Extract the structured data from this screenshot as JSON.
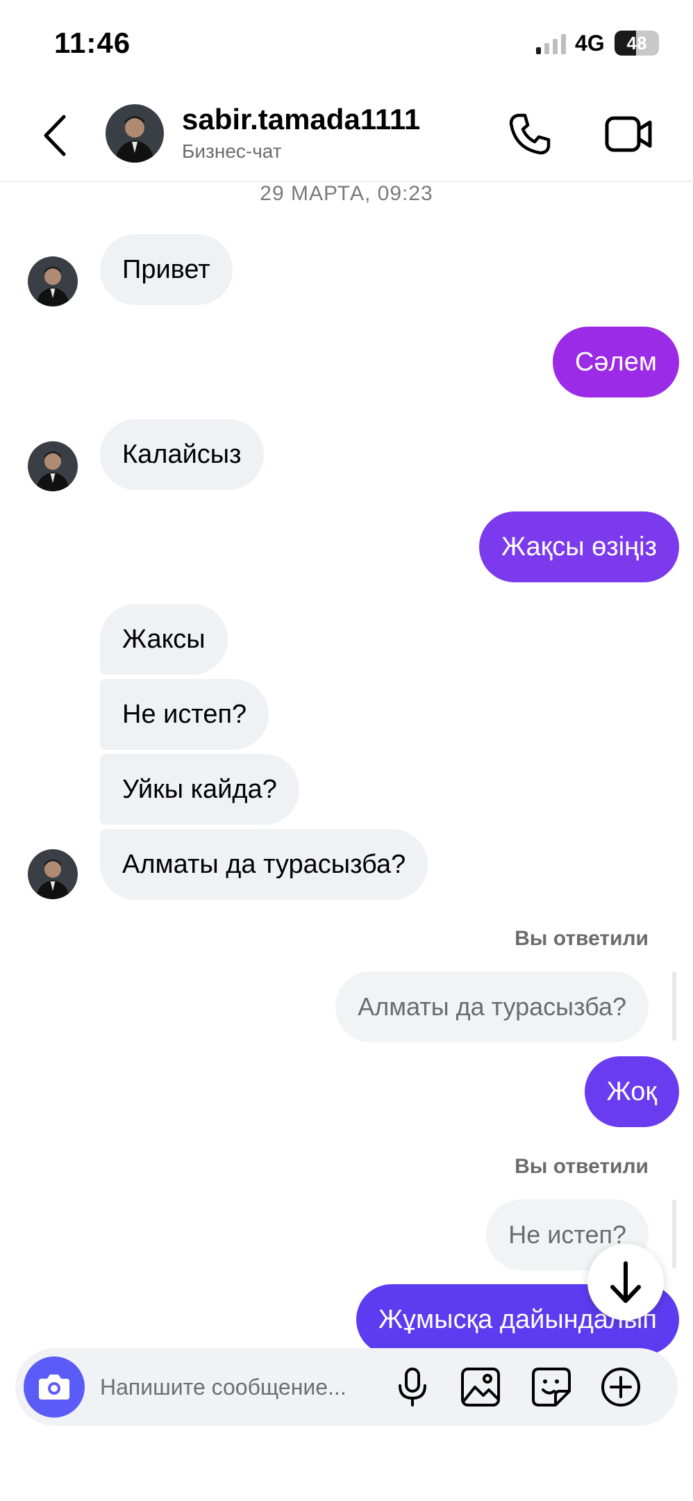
{
  "status_bar": {
    "time": "11:46",
    "network": "4G",
    "battery": "48",
    "battery_level": 0.48
  },
  "header": {
    "username": "sabir.tamada1111",
    "subtitle": "Бизнес-чат"
  },
  "chat": {
    "date_divider": "29 МАРТА, 09:23",
    "messages": [
      {
        "dir": "in",
        "text": "Привет"
      },
      {
        "dir": "out",
        "text": "Сәлем"
      },
      {
        "dir": "in",
        "text": "Калайсыз"
      },
      {
        "dir": "out",
        "text": "Жақсы өзіңіз"
      },
      {
        "dir": "in",
        "text": "Жакcы"
      },
      {
        "dir": "in",
        "text": "Не истеп?"
      },
      {
        "dir": "in",
        "text": "Уйкы кайда?"
      },
      {
        "dir": "in",
        "text": "Алматы да турасызба?"
      },
      {
        "dir": "out",
        "text": "Жоқ",
        "reply_label": "Вы ответили",
        "reply_quote": "Алматы да турасызба?"
      },
      {
        "dir": "out",
        "text": "Жұмысқа дайындалып",
        "reply_label": "Вы ответили",
        "reply_quote": "Не истеп?"
      }
    ]
  },
  "composer": {
    "placeholder": "Напишите сообщение..."
  },
  "colors": {
    "bubble_in": "#eff1f4",
    "out_purple": "#9b2be6",
    "out_violet": "#7c3aed",
    "out_indigo": "#5b3cf0",
    "camera": "#5b5bf7"
  },
  "icons": [
    "back-arrow-icon",
    "phone-icon",
    "video-camera-icon",
    "arrow-down-icon",
    "camera-icon",
    "microphone-icon",
    "image-icon",
    "sticker-icon",
    "plus-circle-icon"
  ]
}
